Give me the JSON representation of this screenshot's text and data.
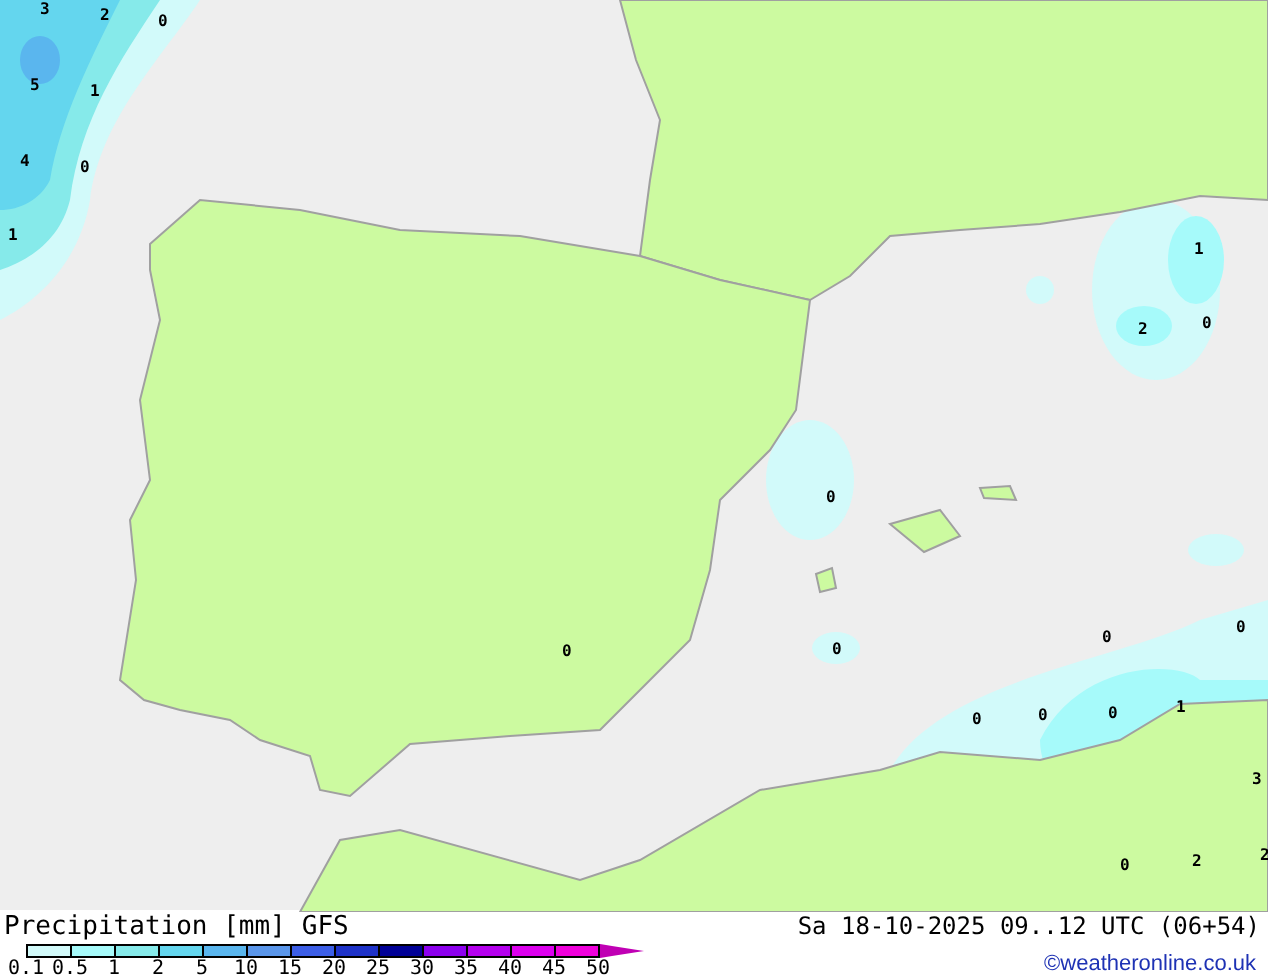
{
  "map_labels": [
    "3",
    "2",
    "0",
    "5",
    "1",
    "4",
    "0",
    "1",
    "1",
    "2",
    "0",
    "0",
    "0",
    "0",
    "0",
    "0",
    "0",
    "0",
    "0",
    "1",
    "3",
    "0",
    "2",
    "2"
  ],
  "title": "Precipitation [mm]",
  "model": "GFS",
  "legend": [
    {
      "label": "0.1",
      "color": "#d2fafa"
    },
    {
      "label": "0.5",
      "color": "#a6fafa"
    },
    {
      "label": "1",
      "color": "#86eaea"
    },
    {
      "label": "2",
      "color": "#64d6ee"
    },
    {
      "label": "5",
      "color": "#5ab6ee"
    },
    {
      "label": "10",
      "color": "#5a96ea"
    },
    {
      "label": "15",
      "color": "#3c5ee6"
    },
    {
      "label": "20",
      "color": "#1e32c8"
    },
    {
      "label": "25",
      "color": "#000096"
    },
    {
      "label": "30",
      "color": "#8c00ee"
    },
    {
      "label": "35",
      "color": "#b400ee"
    },
    {
      "label": "40",
      "color": "#dc00ee"
    },
    {
      "label": "45",
      "color": "#f000dc"
    },
    {
      "label": "50",
      "color": "#c000b4"
    }
  ],
  "valid_time": "Sa 18-10-2025 09..12 UTC (06+54)",
  "credit": "©weatheronline.co.uk"
}
